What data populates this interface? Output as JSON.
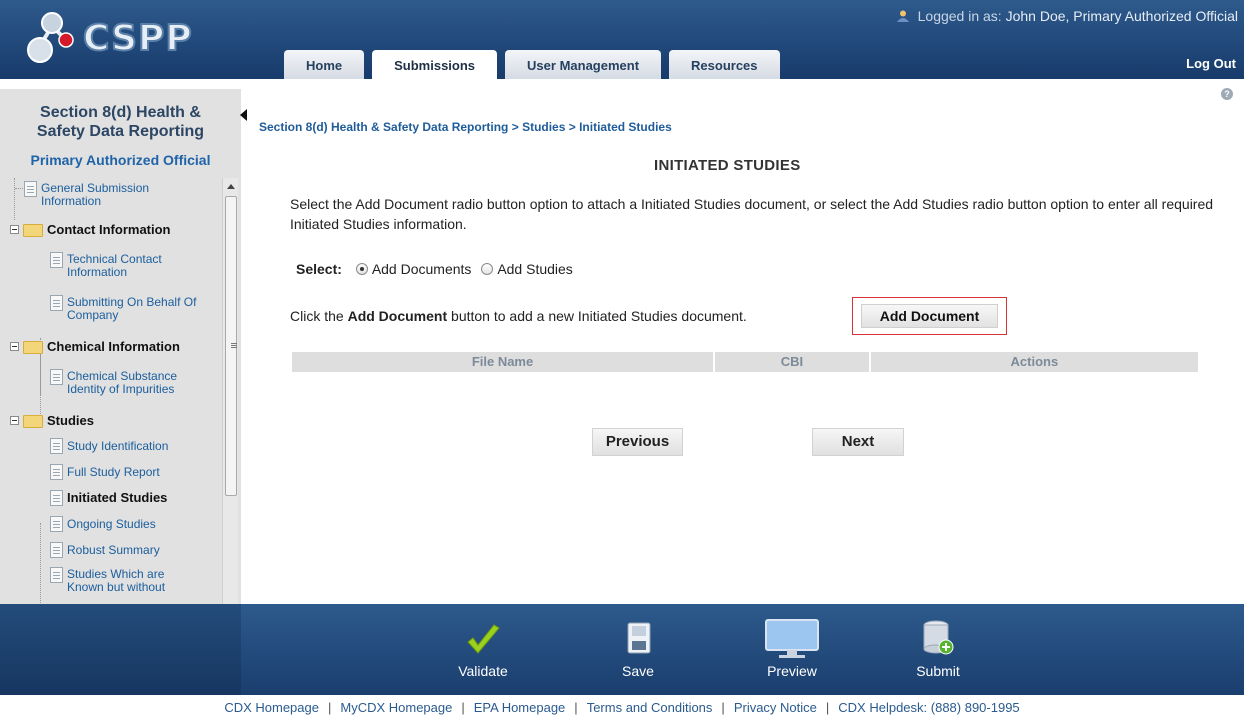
{
  "app": {
    "logo_text": "CSPP"
  },
  "header": {
    "user_label": "Logged in as:",
    "user_name": "John Doe, Primary Authorized Official",
    "tabs": [
      {
        "label": "Home"
      },
      {
        "label": "Submissions",
        "active": true
      },
      {
        "label": "User Management"
      },
      {
        "label": "Resources"
      }
    ],
    "logout_label": "Log Out"
  },
  "sidebar": {
    "title_line1": "Section 8(d) Health &",
    "title_line2": "Safety Data Reporting",
    "role": "Primary Authorized Official",
    "tree": {
      "general_submission": "General Submission Information",
      "contact_information": "Contact Information",
      "technical_contact": "Technical Contact Information",
      "submitting_on_behalf": "Submitting On Behalf Of Company",
      "chemical_information": "Chemical Information",
      "chemical_substance": "Chemical Substance Identity of Impurities",
      "studies": "Studies",
      "study_identification": "Study Identification",
      "full_study_report": "Full Study Report",
      "initiated_studies": "Initiated Studies",
      "ongoing_studies": "Ongoing Studies",
      "robust_summary": "Robust Summary",
      "studies_known": "Studies Which are Known but without"
    }
  },
  "main": {
    "breadcrumb": [
      "Section 8(d) Health & Safety Data Reporting",
      "Studies",
      "Initiated Studies"
    ],
    "breadcrumb_sep": " > ",
    "page_title": "INITIATED STUDIES",
    "instructions": "Select the Add Document radio button option to attach a Initiated Studies document, or select the Add Studies radio button option to enter all required Initiated Studies information.",
    "select_label": "Select:",
    "radio_options": [
      {
        "label": "Add Documents",
        "checked": true
      },
      {
        "label": "Add Studies",
        "checked": false
      }
    ],
    "add_doc_text_pre": "Click the ",
    "add_doc_text_bold": "Add Document",
    "add_doc_text_post": " button to add a new Initiated Studies document.",
    "add_doc_button": "Add Document",
    "table_headers": [
      "File Name",
      "CBI",
      "Actions"
    ],
    "previous_button": "Previous",
    "next_button": "Next"
  },
  "actionbar": {
    "validate": "Validate",
    "save": "Save",
    "preview": "Preview",
    "submit": "Submit"
  },
  "footer": {
    "links": [
      "CDX Homepage",
      "MyCDX Homepage",
      "EPA Homepage",
      "Terms and Conditions",
      "Privacy Notice",
      "CDX Helpdesk: (888) 890-1995"
    ],
    "separator": "|"
  }
}
